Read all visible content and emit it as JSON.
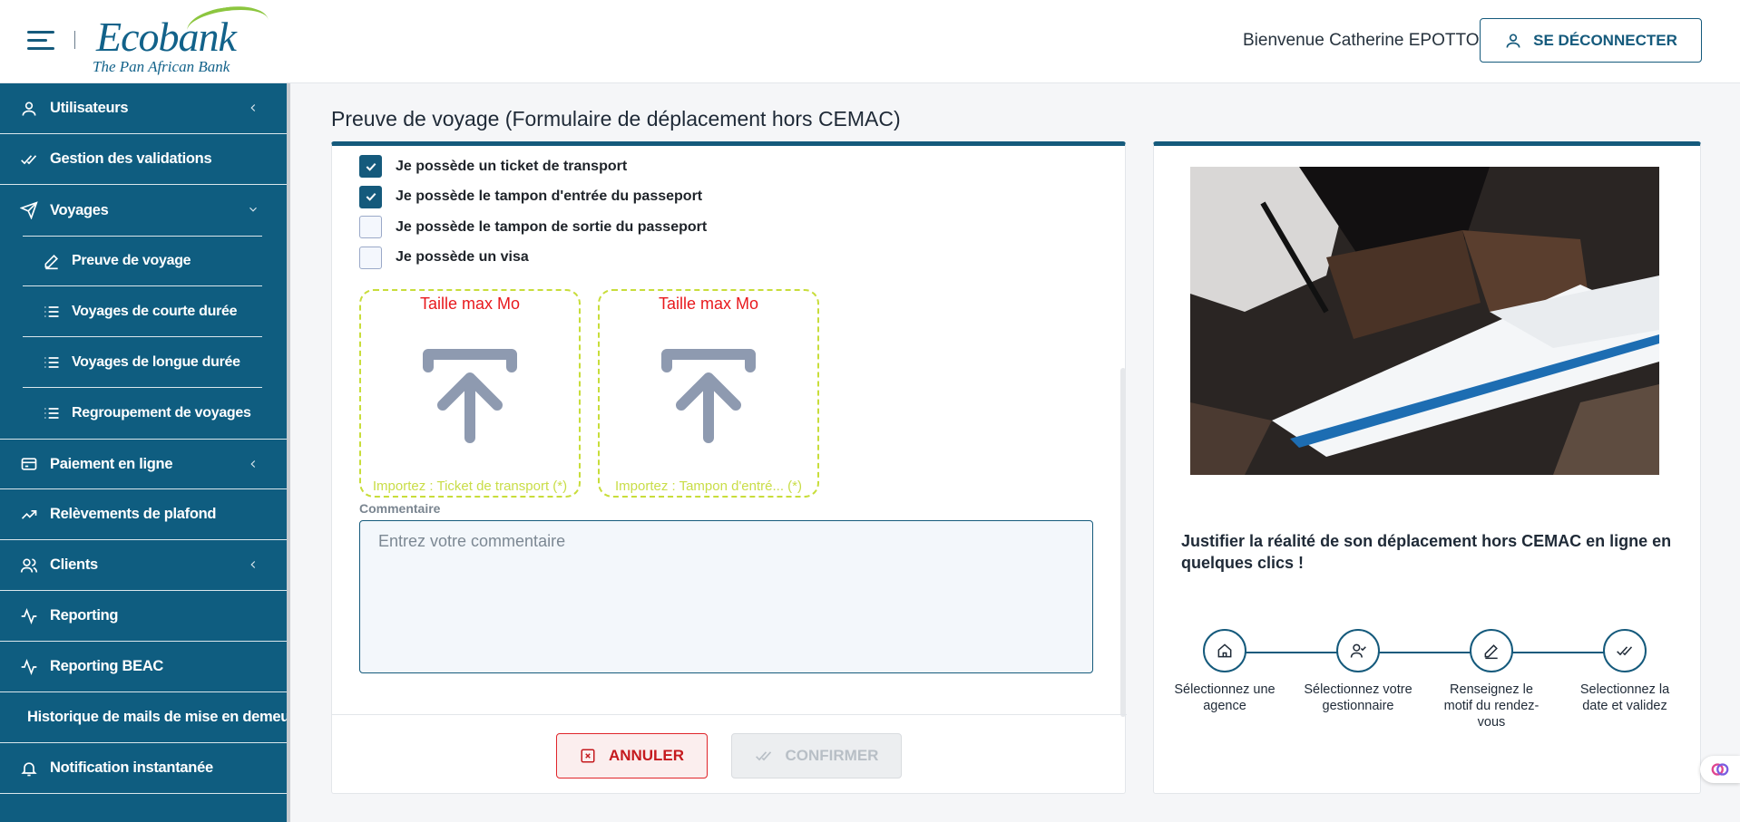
{
  "header": {
    "brand_name": "Ecobank",
    "brand_tagline": "The Pan African Bank",
    "welcome_text": "Bienvenue Catherine EPOTTO",
    "logout_label": "SE DÉCONNECTER"
  },
  "sidebar": {
    "items": [
      {
        "label": "Utilisateurs",
        "icon": "user-icon",
        "chevron": "left"
      },
      {
        "label": "Gestion des validations",
        "icon": "double-check-icon"
      },
      {
        "label": "Voyages",
        "icon": "send-icon",
        "chevron": "down"
      },
      {
        "label": "Paiement en ligne",
        "icon": "card-icon",
        "chevron": "left"
      },
      {
        "label": "Relèvements de plafond",
        "icon": "trend-up-icon"
      },
      {
        "label": "Clients",
        "icon": "users-icon",
        "chevron": "left"
      },
      {
        "label": "Reporting",
        "icon": "activity-icon"
      },
      {
        "label": "Reporting BEAC",
        "icon": "activity-icon"
      },
      {
        "label": "Historique de mails de mise en demeure"
      },
      {
        "label": "Notification instantanée",
        "icon": "bell-icon"
      }
    ],
    "voyages_sub": [
      {
        "label": "Preuve de voyage",
        "icon": "edit-icon"
      },
      {
        "label": "Voyages de courte durée",
        "icon": "list-icon"
      },
      {
        "label": "Voyages de longue durée",
        "icon": "list-icon"
      },
      {
        "label": "Regroupement de voyages",
        "icon": "list-icon"
      }
    ]
  },
  "page": {
    "title": "Preuve de voyage (Formulaire de déplacement hors CEMAC)"
  },
  "form": {
    "checkboxes": [
      {
        "label": "Je possède un ticket de transport",
        "checked": true
      },
      {
        "label": "Je possède le tampon d'entrée du passeport",
        "checked": true
      },
      {
        "label": "Je possède le tampon de sortie du passeport",
        "checked": false
      },
      {
        "label": "Je possède un visa",
        "checked": false
      }
    ],
    "uploads": [
      {
        "max_label": "Taille max Mo",
        "import_label": "Importez : Ticket de transport (*)"
      },
      {
        "max_label": "Taille max Mo",
        "import_label": "Importez : Tampon d'entré... (*)"
      }
    ],
    "comment_label": "Commentaire",
    "comment_placeholder": "Entrez votre commentaire",
    "cancel_label": "ANNULER",
    "confirm_label": "CONFIRMER"
  },
  "info": {
    "headline": "Justifier la réalité de son déplacement hors CEMAC en ligne en quelques clics !",
    "steps": [
      {
        "label": "Sélectionnez une agence",
        "icon": "home-icon"
      },
      {
        "label": "Sélectionnez votre gestionnaire",
        "icon": "user-check-icon"
      },
      {
        "label": "Renseignez le motif du rendez-vous",
        "icon": "edit-icon"
      },
      {
        "label": "Selectionnez la date et validez",
        "icon": "double-check-icon"
      }
    ]
  },
  "colors": {
    "primary": "#155a7c",
    "sidebar": "#0f5d80",
    "danger": "#e0252a",
    "upload_border": "#c8dd3a"
  }
}
